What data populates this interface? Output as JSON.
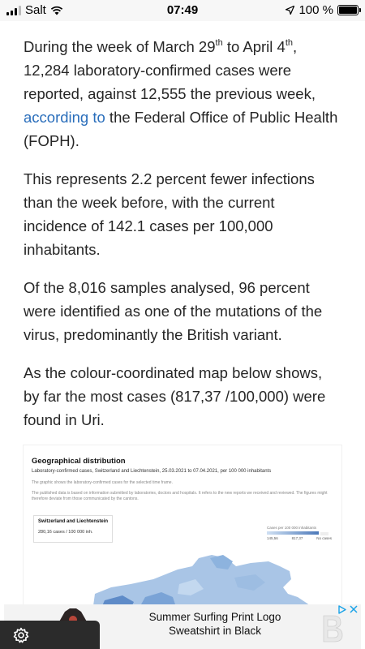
{
  "status_bar": {
    "carrier": "Salt",
    "time": "07:49",
    "battery": "100 %"
  },
  "article": {
    "p1": {
      "part1": "During the week of March 29",
      "sup1": "th",
      "part2": " to April 4",
      "sup2": "th",
      "part3": ", 12,284 laboratory-confirmed cases were reported, against 12,555 the previous week, ",
      "link": "according to",
      "part4": " the Federal Office of Public Health (FOPH)."
    },
    "p2": "This represents 2.2 percent fewer infections than the week before, with the current incidence of 142.1 cases per 100,000 inhabitants.",
    "p3": "Of the 8,016 samples analysed, 96 percent were identified as one of the mutations of the virus, predominantly the British variant.",
    "p4": "As the colour-coordinated map below shows, by far the most cases  (817,37 /100,000) were found in Uri."
  },
  "figure": {
    "title": "Geographical distribution",
    "subtitle": "Laboratory-confirmed cases, Switzerland and Liechtenstein, 25.03.2021 to 07.04.2021, per 100 000 inhabitants",
    "note1": "The graphic shows the laboratory-confirmed cases for the selected time frame.",
    "note2": "The published data is based on information submitted by laboratories, doctors and hospitals. It refers to the new reports we received and reviewed. The figures might therefore deviate from those communicated by the cantons.",
    "card_title": "Switzerland and Liechtenstein",
    "card_value": "280,16 cases / 100 000 inh.",
    "legend_title": "Cases per 100 000 inhabitants",
    "legend_min": "145,56",
    "legend_max": "817,37",
    "legend_nocase": "No cases",
    "colors": {
      "low": "#cfe0f3",
      "high": "#4c79b9"
    }
  },
  "ad": {
    "text": "Summer Surfing Print Logo Sweatshirt in Black"
  },
  "icons": [
    "signal-icon",
    "wifi-icon",
    "location-arrow-icon",
    "battery-icon",
    "adchoices-icon",
    "close-icon",
    "gear-icon"
  ]
}
